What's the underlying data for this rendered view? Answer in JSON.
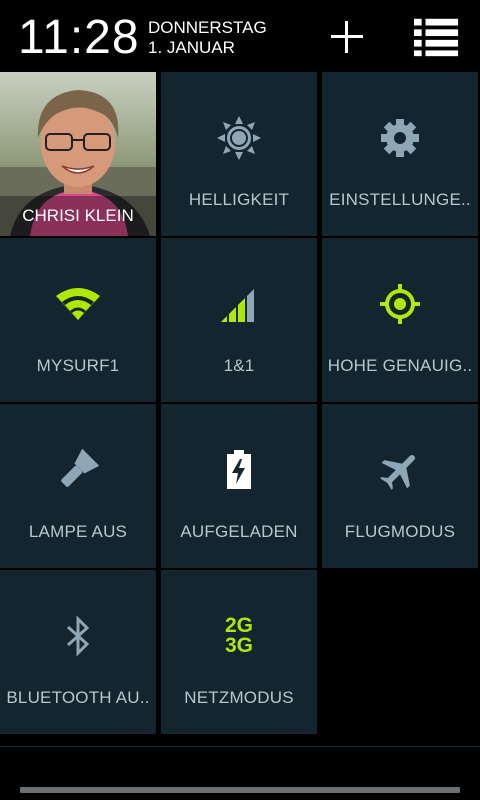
{
  "header": {
    "time": "11:28",
    "weekday": "DONNERSTAG",
    "date": "1. JANUAR",
    "add_icon": "plus-icon",
    "list_icon": "list-icon"
  },
  "profile": {
    "name": "CHRISI KLEIN"
  },
  "tiles": [
    {
      "label": "HELLIGKEIT",
      "icon": "brightness-icon"
    },
    {
      "label": "EINSTELLUNGE..",
      "icon": "settings-gear-icon"
    },
    {
      "label": "MYSURF1",
      "icon": "wifi-icon"
    },
    {
      "label": "1&1",
      "icon": "signal-icon"
    },
    {
      "label": "HOHE GENAUIG..",
      "icon": "location-target-icon"
    },
    {
      "label": "LAMPE AUS",
      "icon": "flashlight-icon"
    },
    {
      "label": "AUFGELADEN",
      "icon": "battery-charging-icon"
    },
    {
      "label": "FLUGMODUS",
      "icon": "airplane-icon"
    },
    {
      "label": "BLUETOOTH AU..",
      "icon": "bluetooth-icon"
    },
    {
      "label": "NETZMODUS",
      "icon": "network-mode-icon",
      "icon_text_top": "2G",
      "icon_text_bottom": "3G"
    }
  ],
  "colors": {
    "tile_bg": "#13252f",
    "accent_active": "#aeea00",
    "icon_inactive": "#8fa6b4",
    "label": "#b9c6cf"
  }
}
